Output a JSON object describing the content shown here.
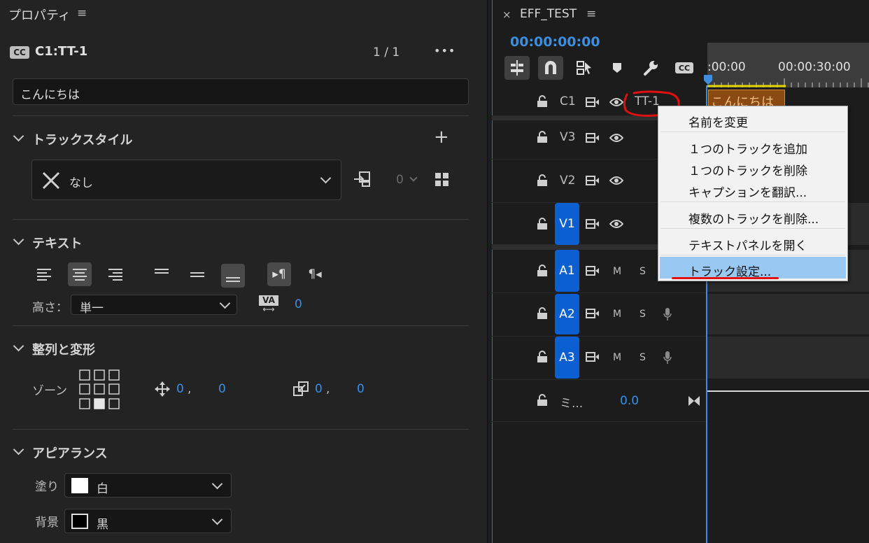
{
  "left": {
    "title": "プロパティ",
    "caption_badge": "CC",
    "caption_track": "C1:TT-1",
    "counter": "1 / 1",
    "more": "•••",
    "text_value": "こんにちは",
    "track_style": {
      "title": "トラックスタイル",
      "add": "+",
      "style_value": "なし",
      "count": "0"
    },
    "text": {
      "title": "テキスト",
      "height_label": "高さ：",
      "height_value": "単一",
      "va_label": "VA",
      "tracking_value": "0"
    },
    "align": {
      "title": "整列と変形",
      "zone_label": "ゾーン",
      "pos_x": "0",
      "pos_y": "0",
      "size_x": "0",
      "size_y": "0",
      "comma": ","
    },
    "appearance": {
      "title": "アピアランス",
      "fill_label": "塗り",
      "fill_value": "白",
      "bg_label": "背景",
      "bg_value": "黒"
    }
  },
  "right": {
    "close": "×",
    "sequence_title": "EFF_TEST",
    "timecode": "00:00:00:00",
    "ruler_start": ":00:00",
    "ruler_30": "00:00:30:00",
    "clip_text": "こんにちは",
    "tracks": {
      "c1": "C1",
      "c1_name": "TT-1",
      "v3": "V3",
      "v2": "V2",
      "v1": "V1",
      "a1": "A1",
      "a2": "A2",
      "a3": "A3",
      "mix": "ミ...",
      "mix_value": "0.0",
      "m": "M",
      "s": "S"
    },
    "context_menu": [
      "名前を変更",
      "１つのトラックを追加",
      "１つのトラックを削除",
      "キャプションを翻訳...",
      "複数のトラックを削除...",
      "テキストパネルを開く",
      "トラック設定..."
    ]
  },
  "colors": {
    "accent_blue": "#0b5fd1",
    "timecode_blue": "#3d8ee0",
    "menu_highlight": "#99c9f3",
    "annotation_red": "#e01010",
    "clip_orange": "#8b4a12"
  }
}
